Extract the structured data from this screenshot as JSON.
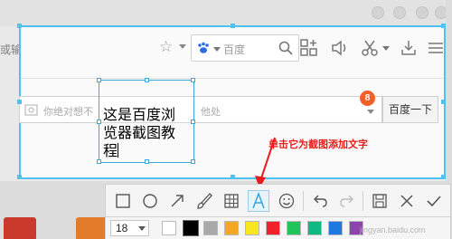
{
  "browser": {
    "address_partial": "或输入网址搜索",
    "search_engine_name": "百度",
    "search_placeholder": "你绝对想不",
    "search_placeholder_end": "他处",
    "baidu_button": "百度一下",
    "badge_count": "8"
  },
  "annotation": {
    "text_line1": "这是百度浏",
    "text_line2": "览器截图教",
    "text_line3": "程",
    "note": "单击它为截图添加文字"
  },
  "toolbar": {
    "tools": [
      "rectangle-tool",
      "ellipse-tool",
      "arrow-tool",
      "brush-tool",
      "mosaic-tool",
      "text-tool",
      "emoji-tool",
      "undo-tool",
      "redo-tool",
      "save-tool",
      "close-tool",
      "confirm-tool"
    ],
    "active_tool": "text-tool"
  },
  "text_options": {
    "font_size": "18",
    "colors": [
      "#ffffff",
      "#000000",
      "#a9a9a9",
      "#f5a623",
      "#f8e71c",
      "#f3212e",
      "#20c55a",
      "#10b981",
      "#1e7ae0",
      "#8e44ad"
    ],
    "selected_color": "#000000"
  },
  "watermark": "jingyan.baidu.com"
}
